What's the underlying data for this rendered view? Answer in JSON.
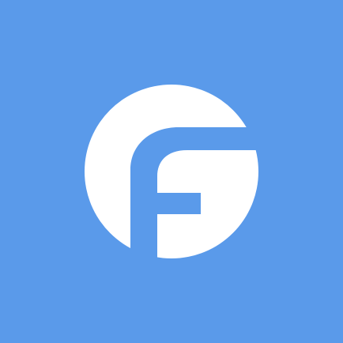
{
  "icon": {
    "name": "f-letter-logo-icon",
    "colors": {
      "background": "#5a9aea",
      "foreground": "#ffffff"
    }
  }
}
